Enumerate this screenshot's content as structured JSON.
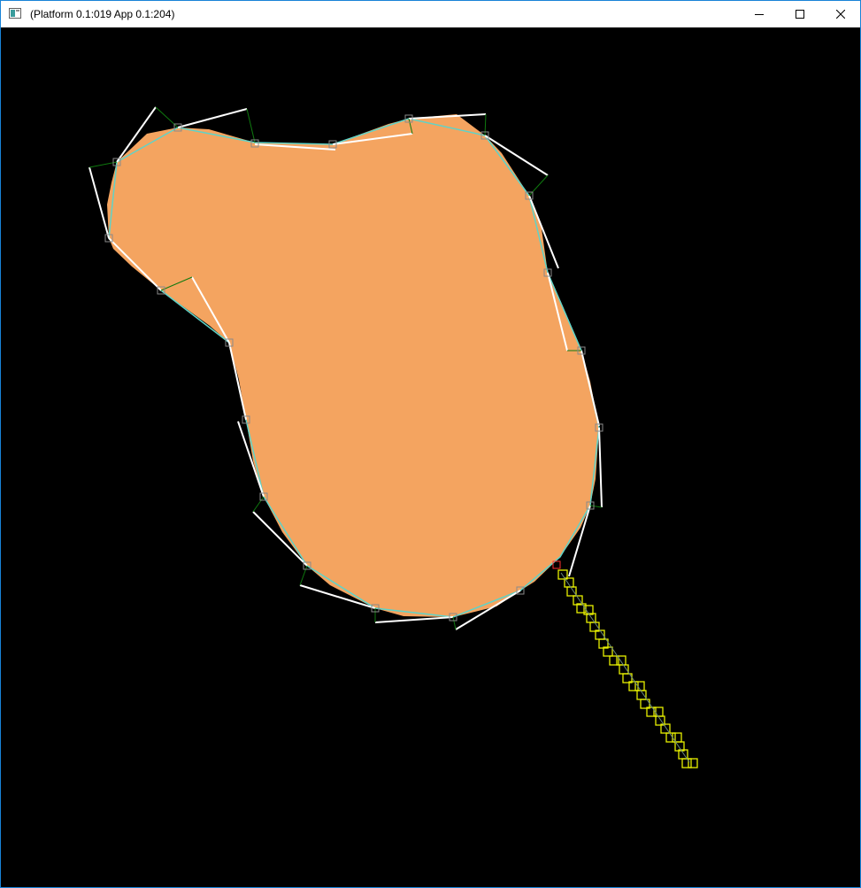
{
  "window": {
    "title": "(Platform 0.1:019 App 0.1:204)",
    "controls": {
      "minimize_icon": "minimize-icon",
      "maximize_icon": "maximize-icon",
      "close_icon": "close-icon"
    }
  },
  "colors": {
    "blob_fill": "#f4a460",
    "contour_line": "#5fd3c8",
    "normal_line": "#ffffff",
    "control_marker": "#8a8a8a",
    "trail_marker": "#ffff00",
    "end_marker": "#ff0000",
    "background": "#000000"
  }
}
